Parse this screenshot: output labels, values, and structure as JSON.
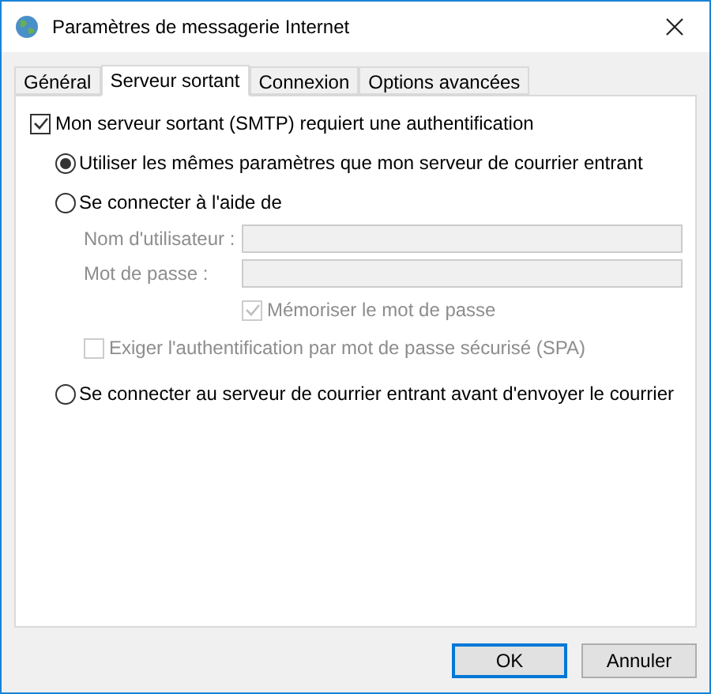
{
  "window": {
    "title": "Paramètres de messagerie Internet"
  },
  "tabs": [
    {
      "label": "Général",
      "selected": false
    },
    {
      "label": "Serveur sortant",
      "selected": true
    },
    {
      "label": "Connexion",
      "selected": false
    },
    {
      "label": "Options avancées",
      "selected": false
    }
  ],
  "smtp_auth": {
    "label": "Mon serveur sortant (SMTP) requiert une authentification",
    "checked": true
  },
  "auth_options": [
    {
      "label": "Utiliser les mêmes paramètres que mon serveur de courrier entrant",
      "selected": true
    },
    {
      "label": "Se connecter à l'aide de",
      "selected": false,
      "fields": [
        {
          "label": "Nom d'utilisateur :",
          "disabled": true
        },
        {
          "label": "Mot de passe :",
          "disabled": true
        }
      ],
      "remember": {
        "label": "Mémoriser le mot de passe",
        "checked": true,
        "disabled": true
      },
      "spa": {
        "label": "Exiger l'authentification par mot de passe sécurisé (SPA)",
        "checked": false,
        "disabled": true
      }
    },
    {
      "label": "Se connecter au serveur de courrier entrant avant d'envoyer le courrier",
      "selected": false
    }
  ],
  "buttons": [
    {
      "label": "OK",
      "default": true
    },
    {
      "label": "Annuler",
      "default": false
    }
  ]
}
